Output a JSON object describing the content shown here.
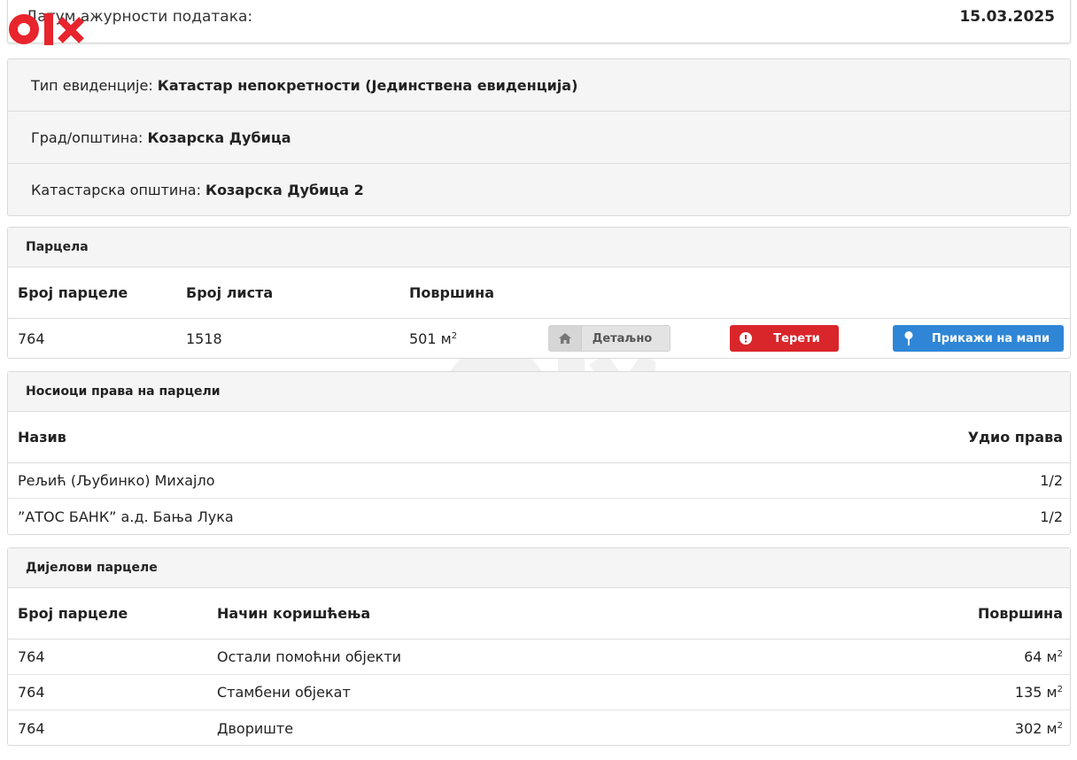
{
  "date_panel": {
    "label": "Датум ажурности података:",
    "value": "15.03.2025"
  },
  "info": [
    {
      "label": "Тип евиденције:",
      "value": "Катастар непокретности (Јединствена евиденција)"
    },
    {
      "label": "Град/општина:",
      "value": "Козарска Дубица"
    },
    {
      "label": "Катастарска општина:",
      "value": "Козарска Дубица 2"
    }
  ],
  "parcel": {
    "title": "Парцела",
    "headers": {
      "number": "Број парцеле",
      "sheet": "Број листа",
      "area": "Површина"
    },
    "row": {
      "number": "764",
      "sheet": "1518",
      "area": "501 м",
      "area_sup": "2"
    },
    "buttons": {
      "detail": "Детаљно",
      "burdens": "Терети",
      "map": "Прикажи на мапи"
    }
  },
  "owners": {
    "title": "Носиоци права на парцели",
    "headers": {
      "name": "Назив",
      "share": "Удио права"
    },
    "rows": [
      {
        "name": "Рељић (Љубинко) Михајло",
        "share": "1/2"
      },
      {
        "name": "”АТОС БАНК” а.д. Бања Лука",
        "share": "1/2"
      }
    ]
  },
  "parts": {
    "title": "Дијелови парцеле",
    "headers": {
      "number": "Број парцеле",
      "usage": "Начин коришћења",
      "area": "Површина"
    },
    "rows": [
      {
        "number": "764",
        "usage": "Остали помоћни објекти",
        "area": "64 м",
        "area_sup": "2"
      },
      {
        "number": "764",
        "usage": "Стамбени објекат",
        "area": "135 м",
        "area_sup": "2"
      },
      {
        "number": "764",
        "usage": "Двориште",
        "area": "302 м",
        "area_sup": "2"
      }
    ]
  },
  "colors": {
    "logo": "#e8242d",
    "burdens_button": "#d9262b",
    "map_button": "#2f86d6",
    "detail_button": "#e3e3e3"
  },
  "icons": {
    "detail": "home-icon",
    "burdens": "exclamation-circle-icon",
    "map": "map-pin-icon",
    "logo": "olx-logo"
  }
}
